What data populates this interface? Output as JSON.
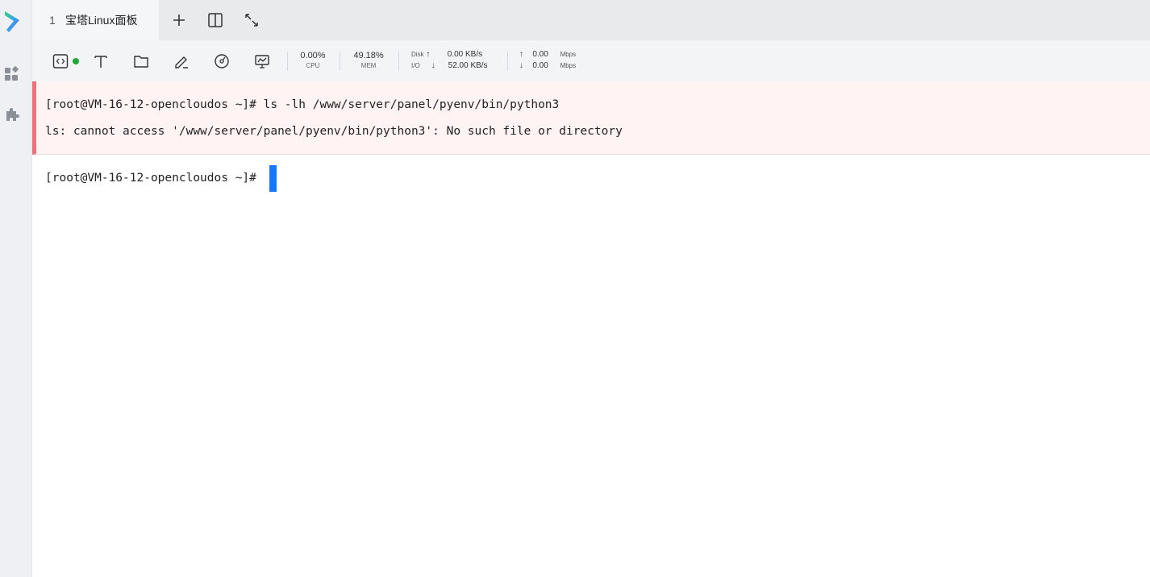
{
  "sidebar": {
    "logo_icon": "baota-logo-icon",
    "items": [
      {
        "icon": "apps-icon"
      },
      {
        "icon": "plugin-icon"
      }
    ]
  },
  "tabs": [
    {
      "index": "1",
      "title": "宝塔Linux面板",
      "active": true
    }
  ],
  "tab_actions": [
    {
      "icon": "plus-icon"
    },
    {
      "icon": "split-view-icon"
    },
    {
      "icon": "expand-icon"
    }
  ],
  "toolbar": {
    "tools": [
      {
        "icon": "code-icon"
      },
      {
        "icon": "text-icon"
      },
      {
        "icon": "folder-icon"
      },
      {
        "icon": "edit-icon"
      },
      {
        "icon": "gauge-icon"
      },
      {
        "icon": "monitor-icon"
      }
    ],
    "status_color": "#20a53a",
    "cpu": {
      "value": "0.00%",
      "label": "CPU"
    },
    "mem": {
      "value": "49.18%",
      "label": "MEM"
    },
    "disk": {
      "label_top": "Disk",
      "label_bottom": "I/O",
      "up_arrow": "↑",
      "down_arrow": "↓",
      "write": "0.00 KB/s",
      "read": "52.00 KB/s"
    },
    "net": {
      "up_arrow": "↑",
      "down_arrow": "↓",
      "up": "0.00",
      "down": "0.00",
      "unit_up": "Mbps",
      "unit_down": "Mbps"
    }
  },
  "terminal": {
    "error_block": {
      "command": "[root@VM-16-12-opencloudos ~]# ls -lh /www/server/panel/pyenv/bin/python3",
      "output": "ls: cannot access '/www/server/panel/pyenv/bin/python3': No such file or directory"
    },
    "prompt": "[root@VM-16-12-opencloudos ~]#",
    "accent_error": "#f0707a",
    "cursor_color": "#1677ff"
  }
}
